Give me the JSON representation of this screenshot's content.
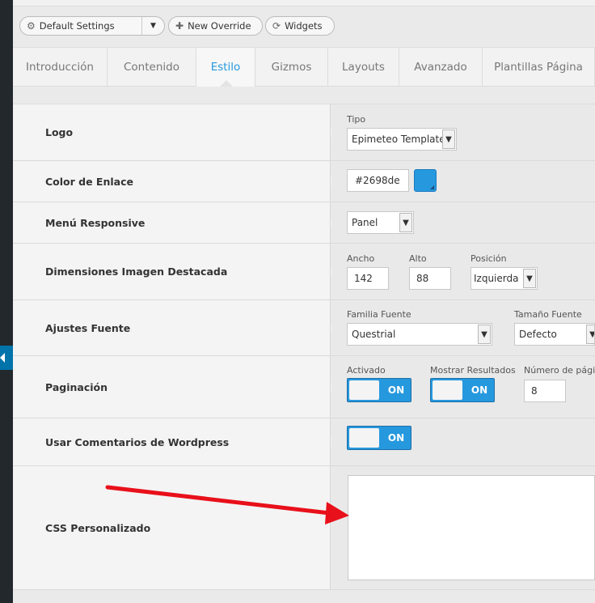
{
  "toolbar": {
    "settings_select_label": "Default Settings",
    "new_override_label": "New Override",
    "widgets_label": "Widgets"
  },
  "tabs": [
    {
      "label": "Introducción",
      "active": false
    },
    {
      "label": "Contenido",
      "active": false
    },
    {
      "label": "Estilo",
      "active": true
    },
    {
      "label": "Gizmos",
      "active": false
    },
    {
      "label": "Layouts",
      "active": false
    },
    {
      "label": "Avanzado",
      "active": false
    },
    {
      "label": "Plantillas Página",
      "active": false
    }
  ],
  "rows": {
    "logo": {
      "label": "Logo",
      "tipo_label": "Tipo",
      "tipo_value": "Epimeteo Template"
    },
    "link_color": {
      "label": "Color de Enlace",
      "value": "#2698de",
      "swatch_color": "#2698de"
    },
    "responsive_menu": {
      "label": "Menú Responsive",
      "value": "Panel"
    },
    "featured_image": {
      "label": "Dimensiones Imagen Destacada",
      "width_label": "Ancho",
      "width_value": "142",
      "height_label": "Alto",
      "height_value": "88",
      "position_label": "Posición",
      "position_value": "Izquierda"
    },
    "font": {
      "label": "Ajustes Fuente",
      "family_label": "Familia Fuente",
      "family_value": "Questrial",
      "size_label": "Tamaño Fuente",
      "size_value": "Defecto"
    },
    "pagination": {
      "label": "Paginación",
      "enabled_label": "Activado",
      "enabled_state": "ON",
      "show_results_label": "Mostrar Resultados",
      "show_results_state": "ON",
      "pages_label": "Número de págin",
      "pages_value": "8"
    },
    "wp_comments": {
      "label": "Usar Comentarios de Wordpress",
      "state": "ON"
    },
    "custom_css": {
      "label": "CSS Personalizado"
    }
  },
  "colors": {
    "accent": "#2698de",
    "annotation_arrow": "#e8101a"
  },
  "icons": {
    "settings": "gear-icon",
    "new_override": "puzzle-icon",
    "widgets": "refresh-icon"
  }
}
